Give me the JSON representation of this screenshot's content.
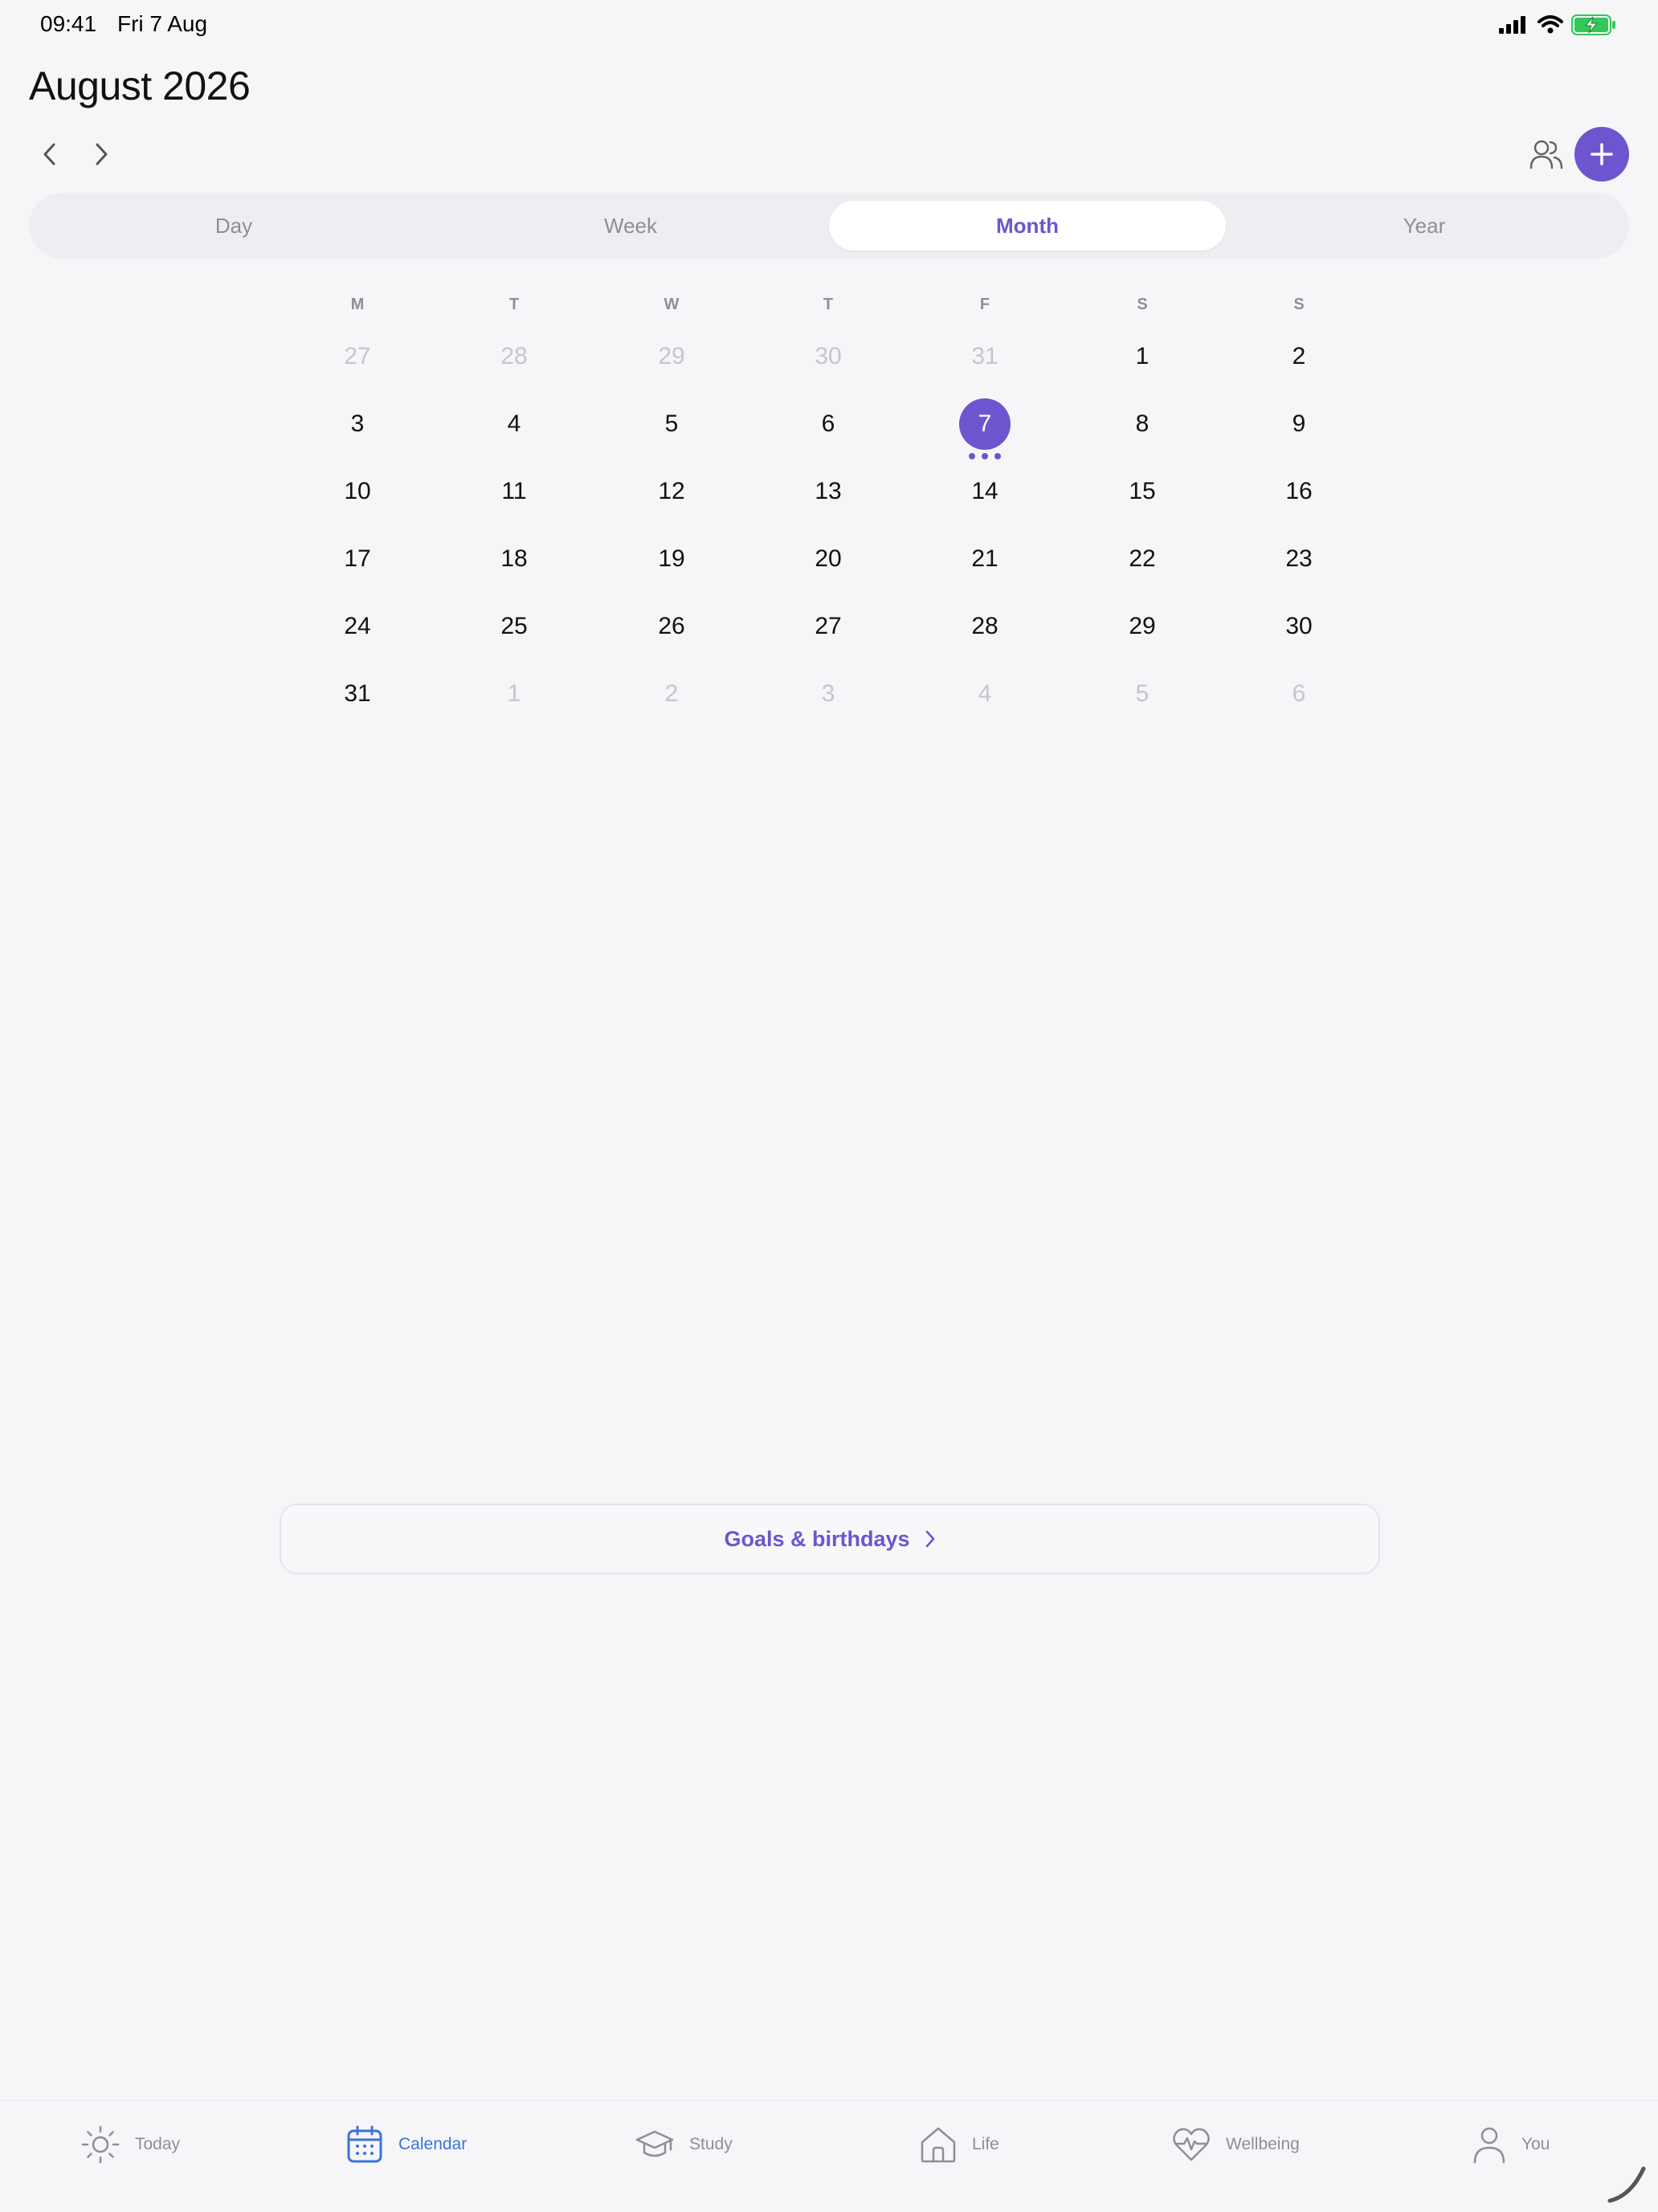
{
  "status_bar": {
    "time": "09:41",
    "date": "Fri 7 Aug"
  },
  "header": {
    "title": "August 2026"
  },
  "view_tabs": [
    {
      "label": "Day",
      "active": false
    },
    {
      "label": "Week",
      "active": false
    },
    {
      "label": "Month",
      "active": true
    },
    {
      "label": "Year",
      "active": false
    }
  ],
  "calendar": {
    "weekdays": [
      "M",
      "T",
      "W",
      "T",
      "F",
      "S",
      "S"
    ],
    "weeks": [
      [
        {
          "d": "27",
          "muted": true
        },
        {
          "d": "28",
          "muted": true
        },
        {
          "d": "29",
          "muted": true
        },
        {
          "d": "30",
          "muted": true
        },
        {
          "d": "31",
          "muted": true
        },
        {
          "d": "1"
        },
        {
          "d": "2"
        }
      ],
      [
        {
          "d": "3"
        },
        {
          "d": "4"
        },
        {
          "d": "5"
        },
        {
          "d": "6"
        },
        {
          "d": "7",
          "today": true,
          "events": 3
        },
        {
          "d": "8"
        },
        {
          "d": "9"
        }
      ],
      [
        {
          "d": "10"
        },
        {
          "d": "11"
        },
        {
          "d": "12"
        },
        {
          "d": "13"
        },
        {
          "d": "14"
        },
        {
          "d": "15"
        },
        {
          "d": "16"
        }
      ],
      [
        {
          "d": "17"
        },
        {
          "d": "18"
        },
        {
          "d": "19"
        },
        {
          "d": "20"
        },
        {
          "d": "21"
        },
        {
          "d": "22"
        },
        {
          "d": "23"
        }
      ],
      [
        {
          "d": "24"
        },
        {
          "d": "25"
        },
        {
          "d": "26"
        },
        {
          "d": "27"
        },
        {
          "d": "28"
        },
        {
          "d": "29"
        },
        {
          "d": "30"
        }
      ],
      [
        {
          "d": "31"
        },
        {
          "d": "1",
          "muted": true
        },
        {
          "d": "2",
          "muted": true
        },
        {
          "d": "3",
          "muted": true
        },
        {
          "d": "4",
          "muted": true
        },
        {
          "d": "5",
          "muted": true
        },
        {
          "d": "6",
          "muted": true
        }
      ]
    ]
  },
  "goals": {
    "label": "Goals & birthdays"
  },
  "tabbar": {
    "items": [
      {
        "label": "Today",
        "icon": "sun-icon",
        "active": false
      },
      {
        "label": "Calendar",
        "icon": "calendar-icon",
        "active": true
      },
      {
        "label": "Study",
        "icon": "graduation-cap-icon",
        "active": false
      },
      {
        "label": "Life",
        "icon": "home-icon",
        "active": false
      },
      {
        "label": "Wellbeing",
        "icon": "heart-pulse-icon",
        "active": false
      },
      {
        "label": "You",
        "icon": "person-icon",
        "active": false
      }
    ]
  },
  "colors": {
    "accent": "#6e55cf",
    "tab_active": "#3b73d9",
    "muted_text": "#8e8e98",
    "background": "#f6f6f9"
  }
}
